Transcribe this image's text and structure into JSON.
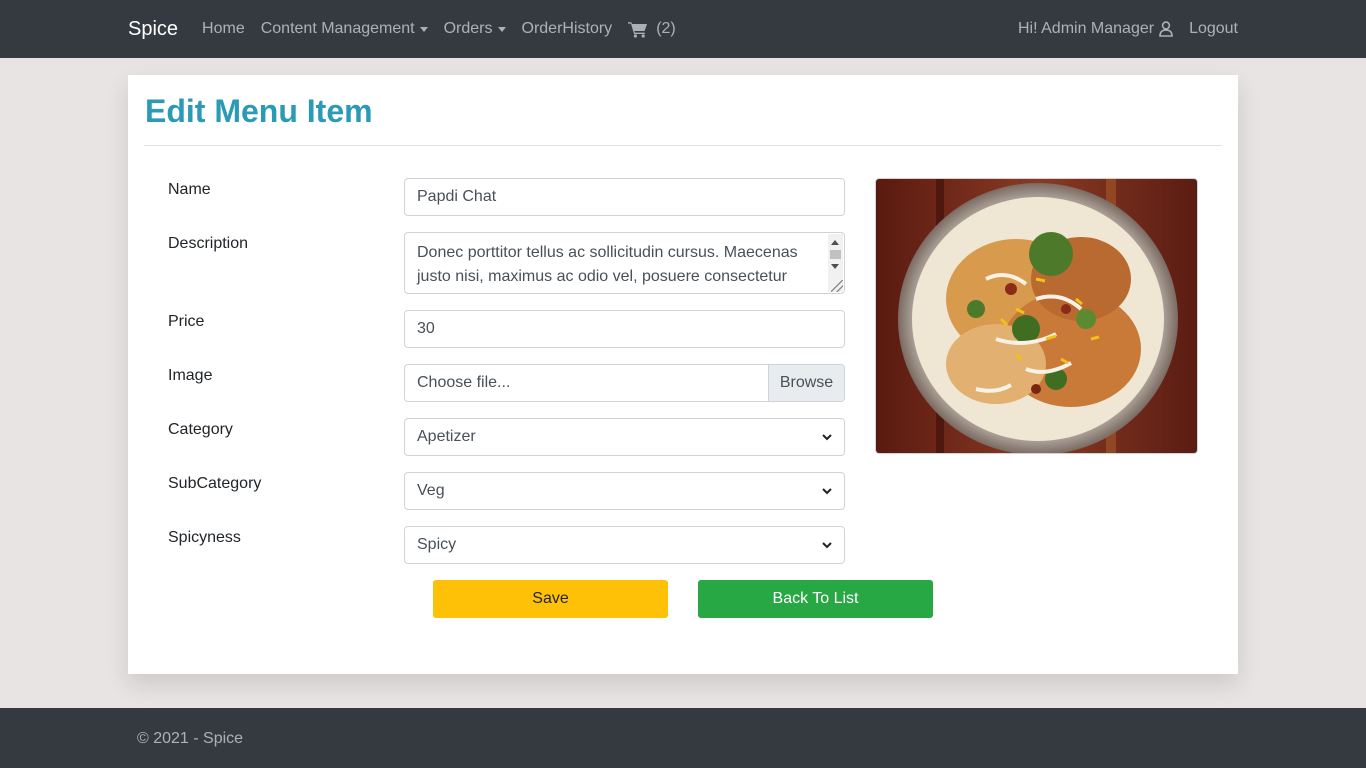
{
  "navbar": {
    "brand": "Spice",
    "home": "Home",
    "content_management": "Content Management",
    "orders": "Orders",
    "order_history": "OrderHistory",
    "cart_count": "(2)",
    "greeting": "Hi! Admin Manager",
    "logout": "Logout"
  },
  "page": {
    "title": "Edit Menu Item"
  },
  "form": {
    "name_label": "Name",
    "name_value": "Papdi Chat",
    "description_label": "Description",
    "description_value": "Donec porttitor tellus ac sollicitudin cursus. Maecenas justo nisi, maximus ac odio vel, posuere consectetur",
    "price_label": "Price",
    "price_value": "30",
    "image_label": "Image",
    "image_placeholder": "Choose file...",
    "browse_label": "Browse",
    "category_label": "Category",
    "category_value": "Apetizer",
    "subcategory_label": "SubCategory",
    "subcategory_value": "Veg",
    "spicyness_label": "Spicyness",
    "spicyness_value": "Spicy",
    "save_label": "Save",
    "back_label": "Back To List"
  },
  "footer": {
    "text": "© 2021 - Spice"
  },
  "colors": {
    "navbar_bg": "#343a40",
    "title": "#2a9ab5",
    "save_button": "#ffc107",
    "back_button": "#28a745",
    "page_bg": "#e8e4e3"
  }
}
